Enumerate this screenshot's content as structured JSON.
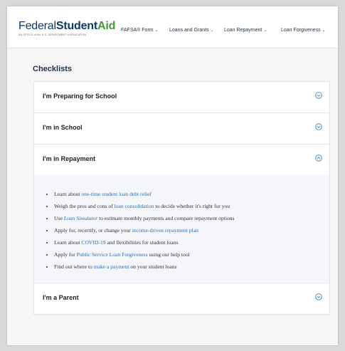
{
  "header": {
    "logo": {
      "federal": "Federal",
      "student": "Student",
      "aid": "Aid",
      "subline": "AN OFFICE of the U.S. DEPARTMENT of EDUCATION"
    },
    "nav": [
      {
        "label": "FAFSA® Form"
      },
      {
        "label": "Loans and Grants"
      },
      {
        "label": "Loan Repayment"
      },
      {
        "label": "Loan Forgiveness"
      }
    ]
  },
  "page_title": "Checklists",
  "accordion": {
    "sections": [
      {
        "label": "I'm Preparing for School",
        "expanded": false
      },
      {
        "label": "I'm in School",
        "expanded": false
      },
      {
        "label": "I'm in Repayment",
        "expanded": true
      },
      {
        "label": "I'm a Parent",
        "expanded": false
      }
    ],
    "repayment_items": [
      {
        "before": "Learn about ",
        "link": "one-time student loan debt relief",
        "after": ""
      },
      {
        "before": "Weigh the pros and cons of ",
        "link": "loan consolidation",
        "after": " to decide whether it's right for you"
      },
      {
        "before": "Use ",
        "link": "Loan Simulator",
        "after": " to estimate monthly payments and compare repayment options"
      },
      {
        "before": "Apply for, recertify, or change your ",
        "link": "income-driven repayment plan",
        "after": ""
      },
      {
        "before": "Learn about ",
        "link": "COVID-19",
        "after": " and flexibilities for student loans"
      },
      {
        "before": "Apply for ",
        "link": "Public Service Loan Forgiveness",
        "after": " using our help tool"
      },
      {
        "before": "Find out where to ",
        "link": "make a payment",
        "after": " on your student loans"
      }
    ]
  },
  "colors": {
    "navy": "#0b3a66",
    "green": "#3d9b2f",
    "link": "#2a6fb5",
    "icon": "#3a7fc0"
  }
}
